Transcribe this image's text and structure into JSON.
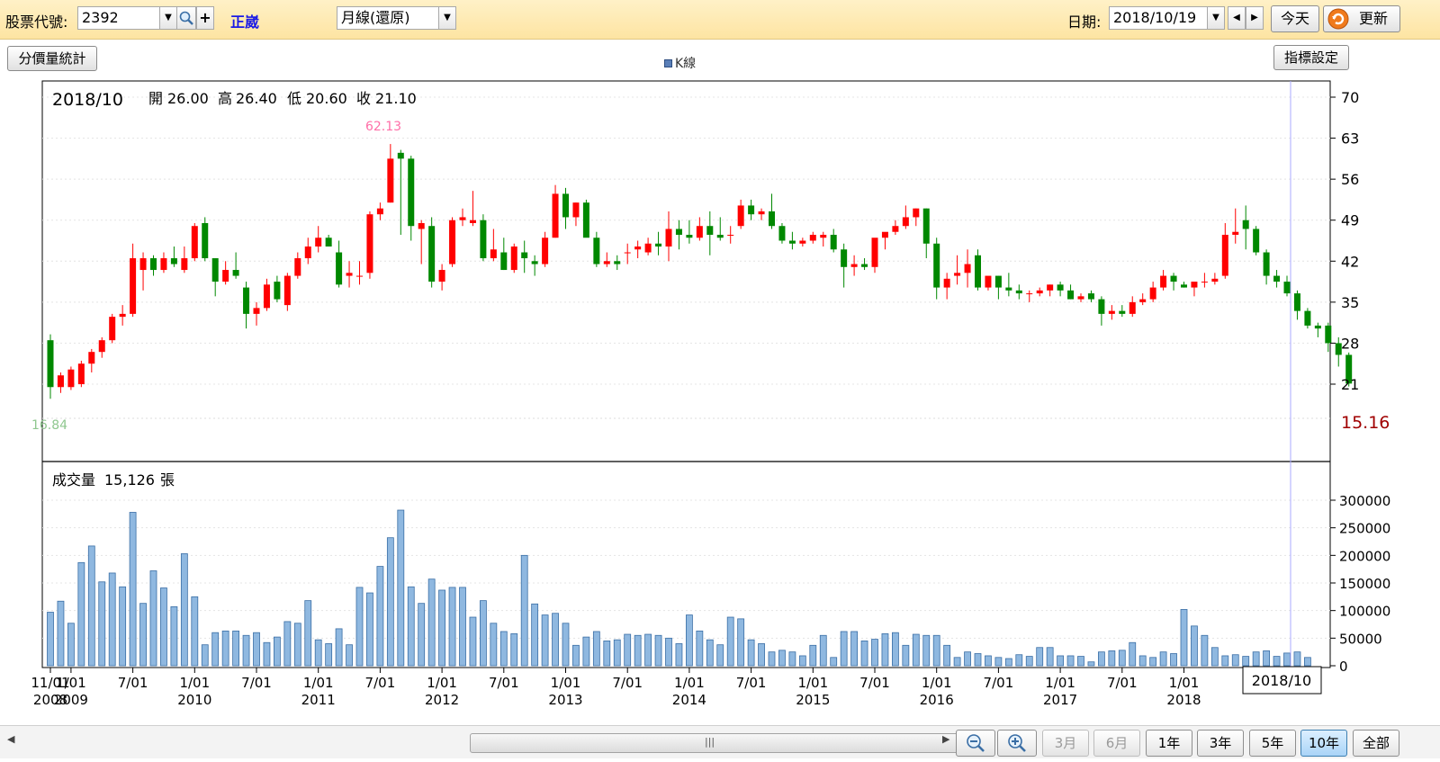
{
  "toolbar": {
    "stock_code_label": "股票代號:",
    "stock_code_value": "2392",
    "stock_name": "正崴",
    "period_value": "月線(還原)",
    "date_label": "日期:",
    "date_value": "2018/10/19",
    "today_label": "今天",
    "refresh_label": "更新",
    "dropdown_glyph": "▼",
    "plus_glyph": "+",
    "prev_glyph": "◀",
    "next_glyph": "▶"
  },
  "subbar": {
    "price_volume_stats_label": "分價量統計",
    "legend_label": "K線",
    "indicator_settings_label": "指標設定"
  },
  "bottom": {
    "ranges": [
      "3月",
      "6月",
      "1年",
      "3年",
      "5年",
      "10年",
      "全部"
    ],
    "active_range": "10年",
    "disabled_ranges": [
      "3月",
      "6月"
    ]
  },
  "colors": {
    "up": "#ff0000",
    "down": "#008800",
    "volume": "#8fb8e0",
    "volume_border": "#3a6ea5",
    "max_label": "#ff6fa8",
    "min_label": "#8fc78f",
    "hint_price": "#a00000"
  },
  "chart_data": [
    {
      "type": "candlestick",
      "info": {
        "date": "2018/10",
        "open_label": "開",
        "open": "26.00",
        "high_label": "高",
        "high": "26.40",
        "low_label": "低",
        "low": "20.60",
        "close_label": "收",
        "close": "21.10"
      },
      "max_label": "62.13",
      "min_label": "16.84",
      "hover_price": "15.16",
      "ylim": [
        14,
        71
      ],
      "yticks": [
        21,
        28,
        35,
        42,
        49,
        56,
        63,
        70
      ],
      "ytick_labels": [
        "21",
        "28",
        "35",
        "42",
        "49",
        "56",
        "63",
        "70"
      ],
      "start_month": "2008-11",
      "ohlc": [
        [
          28.5,
          29.5,
          18.5,
          20.5
        ],
        [
          20.5,
          23.0,
          19.5,
          22.5
        ],
        [
          20.5,
          24.0,
          20.0,
          23.5
        ],
        [
          21.0,
          25.0,
          20.5,
          24.5
        ],
        [
          24.5,
          27.0,
          23.0,
          26.5
        ],
        [
          26.5,
          29.0,
          25.5,
          28.5
        ],
        [
          28.5,
          33.0,
          28.0,
          32.5
        ],
        [
          32.5,
          34.5,
          31.0,
          33.0
        ],
        [
          33.0,
          45.0,
          32.5,
          42.5
        ],
        [
          40.5,
          43.5,
          37.0,
          42.5
        ],
        [
          42.5,
          43.0,
          39.5,
          40.5
        ],
        [
          40.5,
          43.5,
          40.0,
          42.5
        ],
        [
          42.5,
          44.5,
          41.0,
          41.5
        ],
        [
          40.5,
          44.5,
          40.0,
          42.5
        ],
        [
          42.5,
          48.5,
          42.0,
          48.0
        ],
        [
          48.5,
          49.5,
          42.0,
          42.5
        ],
        [
          42.5,
          42.5,
          36.0,
          38.5
        ],
        [
          38.5,
          42.0,
          38.0,
          40.5
        ],
        [
          40.5,
          43.5,
          39.0,
          39.5
        ],
        [
          37.5,
          38.5,
          30.5,
          33.0
        ],
        [
          33.0,
          35.0,
          31.0,
          34.0
        ],
        [
          34.0,
          39.0,
          33.5,
          38.0
        ],
        [
          38.5,
          39.5,
          35.0,
          35.5
        ],
        [
          34.5,
          40.0,
          33.5,
          39.5
        ],
        [
          39.5,
          43.5,
          39.0,
          42.5
        ],
        [
          42.5,
          46.0,
          41.5,
          44.5
        ],
        [
          44.5,
          48.0,
          43.5,
          46.0
        ],
        [
          46.0,
          46.5,
          44.5,
          44.5
        ],
        [
          43.5,
          45.5,
          37.5,
          38.0
        ],
        [
          39.5,
          42.0,
          37.5,
          40.0
        ],
        [
          39.5,
          42.0,
          38.0,
          39.5
        ],
        [
          40.0,
          50.5,
          39.0,
          50.0
        ],
        [
          50.0,
          52.0,
          49.0,
          51.0
        ],
        [
          52.0,
          62.0,
          52.0,
          59.5
        ],
        [
          60.5,
          61.0,
          46.5,
          59.5
        ],
        [
          59.5,
          60.0,
          45.5,
          48.0
        ],
        [
          47.5,
          49.0,
          41.5,
          48.5
        ],
        [
          48.0,
          49.5,
          37.5,
          38.5
        ],
        [
          38.5,
          41.5,
          37.0,
          40.5
        ],
        [
          41.5,
          49.5,
          41.0,
          49.0
        ],
        [
          49.0,
          51.0,
          48.0,
          49.5
        ],
        [
          48.5,
          54.0,
          48.0,
          49.0
        ],
        [
          49.0,
          50.0,
          42.0,
          42.5
        ],
        [
          42.5,
          47.5,
          42.0,
          44.0
        ],
        [
          43.5,
          46.0,
          40.5,
          40.5
        ],
        [
          40.5,
          45.0,
          40.0,
          44.5
        ],
        [
          43.5,
          45.5,
          40.0,
          42.5
        ],
        [
          42.0,
          43.0,
          39.5,
          41.5
        ],
        [
          41.5,
          47.0,
          41.0,
          46.0
        ],
        [
          46.0,
          55.0,
          46.0,
          53.5
        ],
        [
          53.5,
          54.5,
          47.5,
          49.5
        ],
        [
          49.5,
          52.0,
          48.0,
          52.0
        ],
        [
          52.0,
          52.5,
          48.0,
          46.0
        ],
        [
          46.0,
          47.0,
          41.0,
          41.5
        ],
        [
          41.5,
          43.5,
          41.0,
          42.0
        ],
        [
          42.0,
          43.0,
          40.5,
          41.5
        ],
        [
          43.5,
          45.0,
          41.5,
          43.5
        ],
        [
          44.0,
          45.5,
          42.5,
          44.5
        ],
        [
          43.5,
          46.0,
          43.0,
          45.0
        ],
        [
          45.0,
          47.0,
          43.0,
          44.5
        ],
        [
          44.5,
          50.5,
          42.0,
          47.5
        ],
        [
          47.5,
          49.0,
          44.0,
          46.5
        ],
        [
          46.5,
          49.0,
          45.0,
          46.0
        ],
        [
          46.0,
          49.5,
          45.5,
          48.0
        ],
        [
          48.0,
          50.5,
          43.0,
          46.5
        ],
        [
          46.5,
          49.5,
          45.5,
          46.0
        ],
        [
          46.5,
          48.0,
          45.0,
          46.5
        ],
        [
          48.0,
          52.5,
          47.5,
          51.5
        ],
        [
          51.5,
          52.5,
          49.0,
          50.0
        ],
        [
          50.0,
          51.0,
          49.0,
          50.5
        ],
        [
          50.5,
          53.5,
          47.5,
          48.0
        ],
        [
          48.0,
          48.5,
          45.0,
          45.5
        ],
        [
          45.5,
          47.0,
          44.0,
          45.0
        ],
        [
          45.0,
          46.0,
          44.5,
          45.5
        ],
        [
          45.5,
          47.0,
          45.0,
          46.5
        ],
        [
          46.0,
          47.0,
          44.5,
          46.5
        ],
        [
          46.5,
          47.5,
          43.5,
          44.0
        ],
        [
          44.0,
          45.0,
          37.5,
          41.0
        ],
        [
          41.0,
          43.0,
          39.5,
          41.5
        ],
        [
          41.5,
          42.5,
          40.5,
          41.0
        ],
        [
          41.0,
          44.0,
          40.0,
          46.0
        ],
        [
          46.0,
          46.5,
          44.0,
          47.0
        ],
        [
          47.0,
          49.0,
          46.5,
          48.0
        ],
        [
          48.0,
          51.5,
          47.5,
          49.5
        ],
        [
          49.5,
          51.0,
          48.0,
          51.0
        ],
        [
          51.0,
          51.0,
          42.5,
          45.0
        ],
        [
          45.0,
          46.0,
          35.5,
          37.5
        ],
        [
          37.5,
          40.0,
          35.5,
          39.0
        ],
        [
          39.5,
          43.0,
          38.0,
          40.0
        ],
        [
          40.0,
          44.0,
          37.5,
          41.5
        ],
        [
          43.0,
          44.0,
          37.0,
          37.5
        ],
        [
          37.5,
          39.0,
          37.0,
          39.5
        ],
        [
          39.5,
          39.5,
          35.5,
          37.5
        ],
        [
          37.5,
          40.0,
          36.0,
          37.0
        ],
        [
          37.0,
          38.0,
          35.5,
          36.5
        ],
        [
          36.5,
          37.0,
          35.0,
          36.5
        ],
        [
          36.5,
          37.5,
          36.0,
          37.0
        ],
        [
          37.0,
          38.0,
          36.0,
          38.0
        ],
        [
          38.0,
          38.5,
          36.0,
          37.0
        ],
        [
          37.0,
          38.0,
          35.5,
          35.5
        ],
        [
          35.5,
          36.5,
          35.0,
          36.0
        ],
        [
          36.5,
          37.0,
          35.0,
          35.5
        ],
        [
          35.5,
          36.0,
          31.0,
          33.0
        ],
        [
          33.0,
          34.5,
          32.0,
          33.5
        ],
        [
          33.5,
          34.5,
          32.5,
          33.0
        ],
        [
          33.0,
          36.0,
          32.5,
          35.0
        ],
        [
          35.0,
          36.5,
          34.5,
          35.5
        ],
        [
          35.5,
          38.5,
          35.0,
          37.5
        ],
        [
          37.5,
          40.5,
          37.0,
          39.5
        ],
        [
          39.5,
          40.0,
          37.0,
          38.5
        ],
        [
          38.0,
          38.5,
          37.5,
          37.5
        ],
        [
          37.5,
          38.0,
          36.0,
          38.5
        ],
        [
          38.5,
          40.0,
          37.5,
          38.5
        ],
        [
          38.5,
          40.0,
          38.0,
          39.0
        ],
        [
          39.5,
          48.5,
          39.0,
          46.5
        ],
        [
          46.5,
          51.0,
          45.0,
          47.0
        ],
        [
          49.0,
          51.5,
          44.0,
          47.5
        ],
        [
          47.5,
          48.0,
          43.0,
          43.5
        ],
        [
          43.5,
          44.0,
          38.0,
          39.5
        ],
        [
          39.5,
          40.5,
          37.5,
          38.5
        ],
        [
          38.5,
          39.5,
          36.0,
          36.5
        ],
        [
          36.5,
          37.0,
          32.0,
          33.5
        ],
        [
          33.5,
          34.0,
          30.5,
          31.0
        ],
        [
          31.0,
          31.5,
          29.0,
          30.5
        ],
        [
          31.0,
          31.5,
          26.5,
          28.0
        ],
        [
          28.0,
          29.0,
          24.0,
          26.0
        ],
        [
          26.0,
          26.4,
          20.6,
          21.1
        ]
      ]
    },
    {
      "type": "bar",
      "series_name": "成交量",
      "info_label": "成交量",
      "info_value": "15,126",
      "info_unit": "張",
      "ylim": [
        0,
        330000
      ],
      "yticks": [
        0,
        50000,
        100000,
        150000,
        200000,
        250000,
        300000
      ],
      "ytick_labels": [
        "0",
        "50000",
        "100000",
        "150000",
        "200000",
        "250000",
        "300000"
      ],
      "values": [
        97000,
        117000,
        77000,
        187000,
        217000,
        152000,
        168000,
        143000,
        278000,
        113000,
        172000,
        141000,
        107000,
        203000,
        125000,
        38000,
        60000,
        63000,
        63000,
        55000,
        60000,
        42000,
        52000,
        80000,
        77000,
        118000,
        47000,
        40000,
        67000,
        38000,
        142000,
        132000,
        180000,
        232000,
        282000,
        143000,
        113000,
        157000,
        137000,
        142000,
        142000,
        88000,
        118000,
        77000,
        62000,
        58000,
        200000,
        112000,
        92000,
        95000,
        77000,
        37000,
        52000,
        62000,
        45000,
        47000,
        57000,
        55000,
        57000,
        55000,
        50000,
        40000,
        92000,
        63000,
        47000,
        38000,
        88000,
        85000,
        47000,
        40000,
        25000,
        28000,
        25000,
        18000,
        37000,
        55000,
        15000,
        62000,
        62000,
        45000,
        48000,
        58000,
        60000,
        37000,
        57000,
        55000,
        55000,
        37000,
        15000,
        25000,
        22000,
        18000,
        15000,
        13000,
        20000,
        17000,
        33000,
        33000,
        18000,
        18000,
        17000,
        7000,
        25000,
        27000,
        28000,
        42000,
        18000,
        15000,
        25000,
        22000,
        102000,
        72000,
        55000,
        33000,
        18000,
        20000,
        17000,
        25000,
        27000,
        17000,
        23000,
        25000,
        15000
      ],
      "xtick_labels": [
        {
          "i": 0,
          "top": "11/01",
          "bottom": "2008"
        },
        {
          "i": 2,
          "top": "1/01",
          "bottom": "2009"
        },
        {
          "i": 8,
          "top": "7/01",
          "bottom": ""
        },
        {
          "i": 14,
          "top": "1/01",
          "bottom": "2010"
        },
        {
          "i": 20,
          "top": "7/01",
          "bottom": ""
        },
        {
          "i": 26,
          "top": "1/01",
          "bottom": "2011"
        },
        {
          "i": 32,
          "top": "7/01",
          "bottom": ""
        },
        {
          "i": 38,
          "top": "1/01",
          "bottom": "2012"
        },
        {
          "i": 44,
          "top": "7/01",
          "bottom": ""
        },
        {
          "i": 50,
          "top": "1/01",
          "bottom": "2013"
        },
        {
          "i": 56,
          "top": "7/01",
          "bottom": ""
        },
        {
          "i": 62,
          "top": "1/01",
          "bottom": "2014"
        },
        {
          "i": 68,
          "top": "7/01",
          "bottom": ""
        },
        {
          "i": 74,
          "top": "1/01",
          "bottom": "2015"
        },
        {
          "i": 80,
          "top": "7/01",
          "bottom": ""
        },
        {
          "i": 86,
          "top": "1/01",
          "bottom": "2016"
        },
        {
          "i": 92,
          "top": "7/01",
          "bottom": ""
        },
        {
          "i": 98,
          "top": "1/01",
          "bottom": "2017"
        },
        {
          "i": 104,
          "top": "7/01",
          "bottom": ""
        },
        {
          "i": 110,
          "top": "1/01",
          "bottom": "2018"
        }
      ],
      "cursor_label": "2018/10"
    }
  ]
}
